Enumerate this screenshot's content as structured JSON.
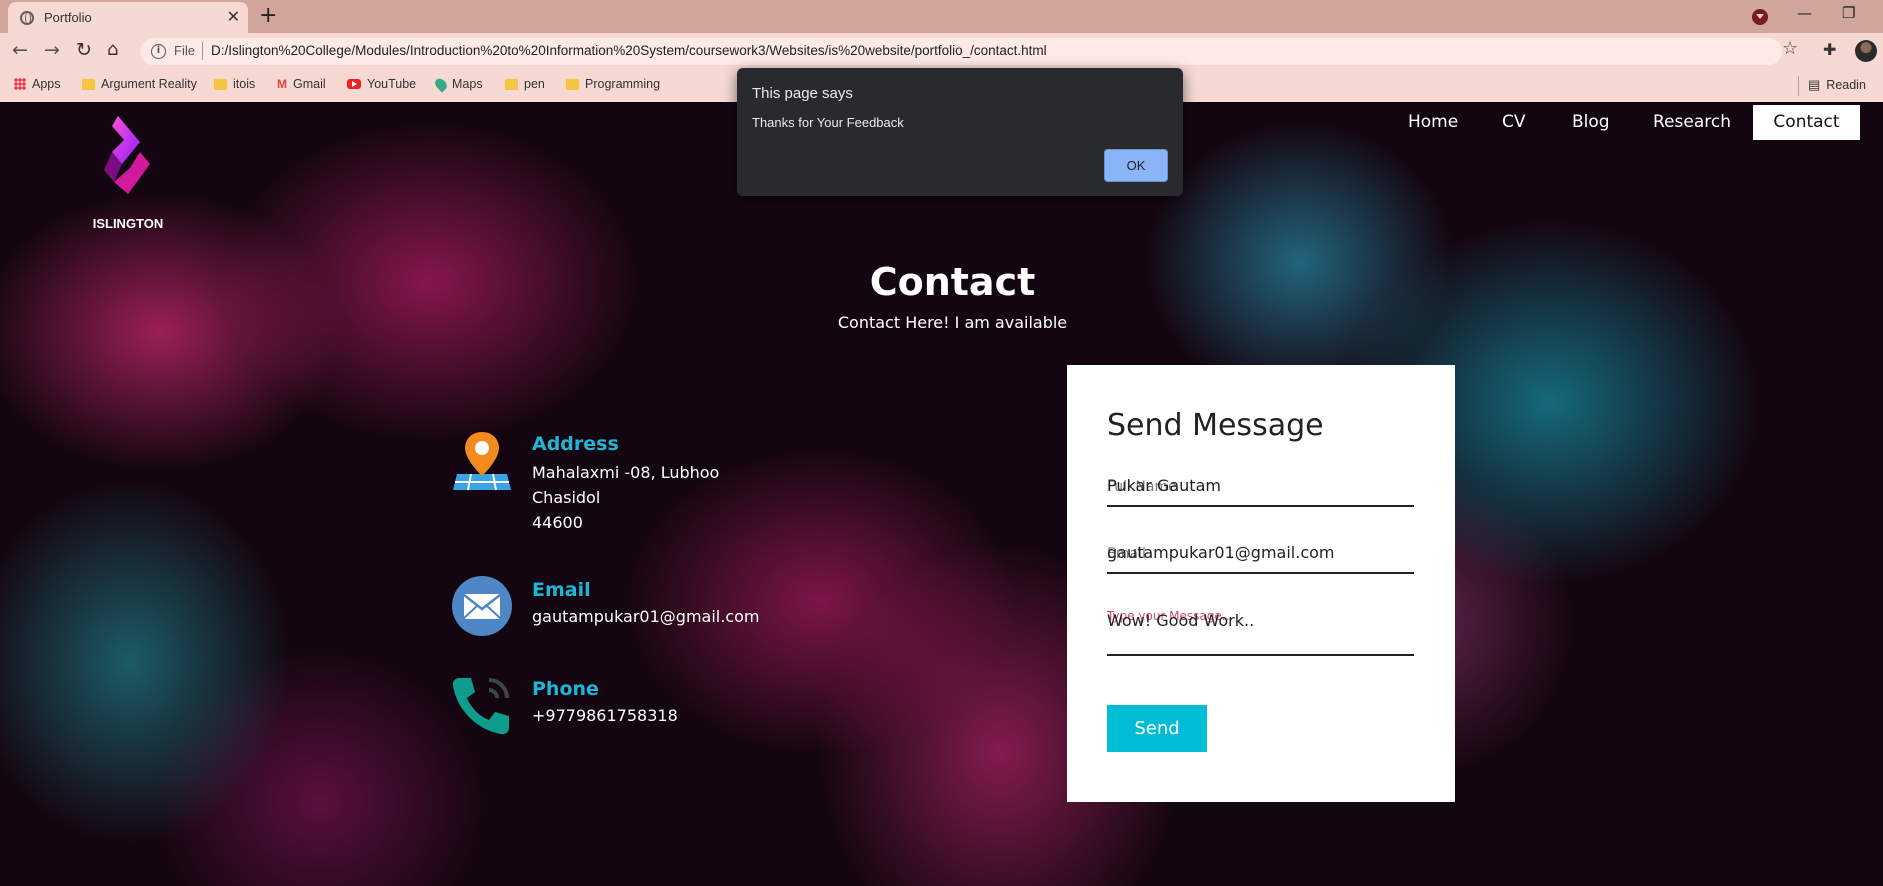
{
  "browser": {
    "tab_title": "Portfolio",
    "tab_close": "✕",
    "new_tab": "+",
    "address_scheme": "File",
    "address_url": "D:/Islington%20College/Modules/Introduction%20to%20Information%20System/coursework3/Websites/is%20website/portfolio_/contact.html",
    "bookmarks": [
      {
        "label": "Apps",
        "icon": "apps-icon"
      },
      {
        "label": "Argument Reality",
        "icon": "folder-icon"
      },
      {
        "label": "itois",
        "icon": "folder-icon"
      },
      {
        "label": "Gmail",
        "icon": "gmail-icon"
      },
      {
        "label": "YouTube",
        "icon": "youtube-icon"
      },
      {
        "label": "Maps",
        "icon": "maps-icon"
      },
      {
        "label": "pen",
        "icon": "folder-icon"
      },
      {
        "label": "Programming",
        "icon": "folder-icon"
      }
    ],
    "reading_list": "Readin"
  },
  "site": {
    "logo_text": "ISLINGTON",
    "nav": [
      {
        "label": "Home",
        "active": false
      },
      {
        "label": "CV",
        "active": false
      },
      {
        "label": "Blog",
        "active": false
      },
      {
        "label": "Research",
        "active": false
      },
      {
        "label": "Contact",
        "active": true
      }
    ],
    "title": "Contact",
    "subtitle": "Contact Here! I am available",
    "address": {
      "label": "Address",
      "lines": [
        "Mahalaxmi -08, Lubhoo",
        "Chasidol",
        "44600"
      ]
    },
    "email": {
      "label": "Email",
      "value": "gautampukar01@gmail.com"
    },
    "phone": {
      "label": "Phone",
      "value": "+9779861758318"
    },
    "form": {
      "title": "Send Message",
      "name_label": "Full Name",
      "name_value": "Pukar Gautam",
      "email_label": "Email",
      "email_value": "gautampukar01@gmail.com",
      "message_label": "Type your Message...",
      "message_value": "Wow! Good Work..",
      "send_label": "Send"
    }
  },
  "alert": {
    "heading": "This page says",
    "message": "Thanks for Your Feedback",
    "ok_label": "OK"
  },
  "colors": {
    "accent": "#00bcd4",
    "info_label": "#1fb6d6",
    "dialog_bg": "#292a2d",
    "dialog_button": "#8ab4f8"
  }
}
